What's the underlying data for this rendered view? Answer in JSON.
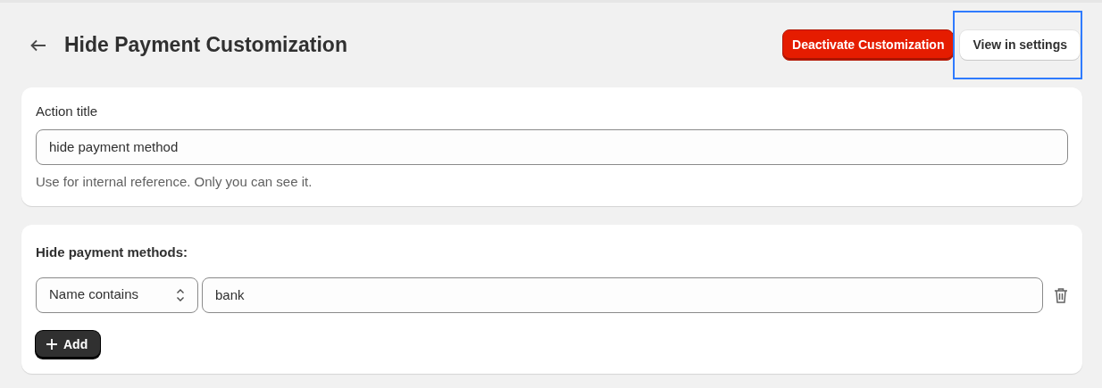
{
  "header": {
    "title": "Hide Payment Customization",
    "actions": [
      {
        "label": "Deactivate Customization",
        "kind": "danger",
        "highlighted": false
      },
      {
        "label": "View in settings",
        "kind": "secondary",
        "highlighted": true
      }
    ]
  },
  "title_card": {
    "label": "Action title",
    "value": "hide payment method",
    "help": "Use for internal reference. Only you can see it."
  },
  "methods_card": {
    "heading": "Hide payment methods:",
    "conditions": [
      {
        "operator": "Name contains",
        "value": "bank"
      }
    ],
    "add_button": "Add"
  }
}
